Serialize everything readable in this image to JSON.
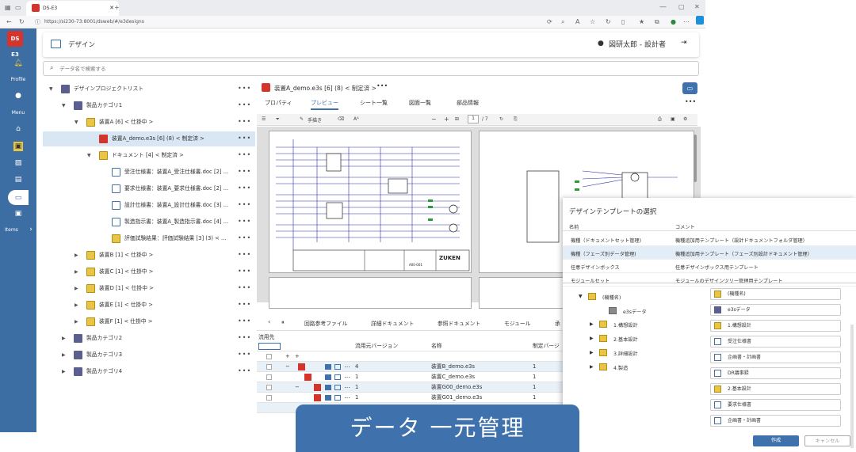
{
  "browser": {
    "tab_title": "DS-E3",
    "url": "https://si230-73:8001/dsweb/#/e3designs"
  },
  "nav": {
    "logo": "DS E3",
    "profile_label": "Profile",
    "menu_label": "Menu",
    "items_label": "Items"
  },
  "header": {
    "title": "デザイン",
    "user": "図研太郎 - 設計者"
  },
  "search": {
    "placeholder": "データ名で検索する"
  },
  "tree": [
    {
      "label": "デザインプロジェクトリスト",
      "level": 0,
      "expander": "▼",
      "icon": "ic-cat"
    },
    {
      "label": "製品カテゴリ1",
      "level": 1,
      "expander": "▼",
      "icon": "ic-cat"
    },
    {
      "label": "装置A [6] < 仕掛中 >",
      "level": 2,
      "expander": "▼",
      "icon": "ic-folder"
    },
    {
      "label": "装置A_demo.e3s [6] (8) < 制定済 >",
      "level": 3,
      "expander": "",
      "icon": "ic-red",
      "selected": true
    },
    {
      "label": "ドキュメント [4] < 制定済 >",
      "level": 3,
      "expander": "▼",
      "icon": "ic-folder"
    },
    {
      "label": "受注仕様書：装置A_受注仕様書.doc [2] ...",
      "level": 4,
      "expander": "",
      "icon": "ic-doc"
    },
    {
      "label": "要求仕様書：装置A_要求仕様書.doc [2] ...",
      "level": 4,
      "expander": "",
      "icon": "ic-doc"
    },
    {
      "label": "設計仕様書：装置A_設計仕様書.doc [3] ...",
      "level": 4,
      "expander": "",
      "icon": "ic-doc"
    },
    {
      "label": "製造指示書：装置A_製造指示書.doc [4] ...",
      "level": 4,
      "expander": "",
      "icon": "ic-doc"
    },
    {
      "label": "評価試験結果：評価試験結果 [3] (3) < ...",
      "level": 4,
      "expander": "",
      "icon": "ic-folder"
    },
    {
      "label": "装置B [1] < 仕掛中 >",
      "level": 2,
      "expander": "▶",
      "icon": "ic-folder"
    },
    {
      "label": "装置C [1] < 仕掛中 >",
      "level": 2,
      "expander": "▶",
      "icon": "ic-folder"
    },
    {
      "label": "装置D [1] < 仕掛中 >",
      "level": 2,
      "expander": "▶",
      "icon": "ic-folder"
    },
    {
      "label": "装置E [1] < 仕掛中 >",
      "level": 2,
      "expander": "▶",
      "icon": "ic-folder"
    },
    {
      "label": "装置F [1] < 仕掛中 >",
      "level": 2,
      "expander": "▶",
      "icon": "ic-folder"
    },
    {
      "label": "製品カテゴリ2",
      "level": 1,
      "expander": "▶",
      "icon": "ic-cat"
    },
    {
      "label": "製品カテゴリ3",
      "level": 1,
      "expander": "▶",
      "icon": "ic-cat"
    },
    {
      "label": "製品カテゴリ4",
      "level": 1,
      "expander": "▶",
      "icon": "ic-cat"
    }
  ],
  "detail": {
    "title": "装置A_demo.e3s [6] (8) < 制定済 >",
    "tabs": [
      "プロパティ",
      "プレビュー",
      "シート一覧",
      "図面一覧",
      "部品情報"
    ],
    "active_tab": "プレビュー",
    "pdf_toolbar": {
      "draw": "手描き",
      "page": "1",
      "page_total": "/ 7"
    },
    "drawing_text": {
      "company": "ZUKEN",
      "drawing_no": "A00-001"
    }
  },
  "bottom": {
    "tabs": [
      "回路参考ファイル",
      "詳細ドキュメント",
      "参照ドキュメント",
      "モジュール",
      "承"
    ],
    "section_label": "流用先",
    "col_version": "流用元バージョン",
    "col_name": "名称",
    "col_rev": "制定バージ",
    "rows": [
      {
        "version": "4",
        "name": "装置B_demo.e3s",
        "rev": "1"
      },
      {
        "version": "1",
        "name": "装置C_demo.e3s",
        "rev": "1"
      },
      {
        "version": "1",
        "name": "装置G00_demo.e3s",
        "rev": "1"
      },
      {
        "version": "1",
        "name": "装置G01_demo.e3s",
        "rev": "1"
      }
    ]
  },
  "dialog": {
    "title": "デザインテンプレートの選択",
    "col_name": "名前",
    "col_comment": "コメント",
    "templates": [
      {
        "name": "機種（ドキュメントセット管理)",
        "comment": "機種追加用テンプレート（設計ドキュメントフォルダ管理）"
      },
      {
        "name": "機種（フェーズ別データ管理)",
        "comment": "機種追加用テンプレート（フェーズ別設計ドキュメント管理）"
      },
      {
        "name": "任意デザインボックス",
        "comment": "任意デザインボックス用テンプレート"
      },
      {
        "name": "モジュールセット",
        "comment": "モジュールのデザインツリー管理用テンプレート"
      }
    ],
    "left_tree": [
      {
        "label": "(機種名)",
        "indent": 0,
        "exp": "▼"
      },
      {
        "label": "e3sデータ",
        "indent": 1,
        "exp": ""
      },
      {
        "label": "1.構想設計",
        "indent": 1,
        "exp": "▶"
      },
      {
        "label": "2.基本設計",
        "indent": 1,
        "exp": "▶"
      },
      {
        "label": "3.詳細設計",
        "indent": 1,
        "exp": "▶"
      },
      {
        "label": "4.製造",
        "indent": 1,
        "exp": "▶"
      }
    ],
    "right_list": [
      {
        "label": "(機種名)",
        "icon": "ic-folder"
      },
      {
        "label": "e3sデータ",
        "icon": "ic-cat"
      },
      {
        "label": "1.構想設計",
        "icon": "ic-folder"
      },
      {
        "label": "受注仕様書",
        "icon": "ic-doc"
      },
      {
        "label": "企画書・計画書",
        "icon": "ic-doc"
      },
      {
        "label": "DR議事録",
        "icon": "ic-doc"
      },
      {
        "label": "2.基本設計",
        "icon": "ic-folder"
      },
      {
        "label": "要求仕様書",
        "icon": "ic-doc"
      },
      {
        "label": "企画書・計画書",
        "icon": "ic-doc"
      }
    ],
    "create_label": "作成",
    "cancel_label": "キャンセル"
  },
  "caption": "データ 一元管理",
  "colors": {
    "nav": "#3c6ea3",
    "accent": "#3f72ad",
    "brand_red": "#d4342c",
    "selected_row": "#d9e6f3"
  }
}
